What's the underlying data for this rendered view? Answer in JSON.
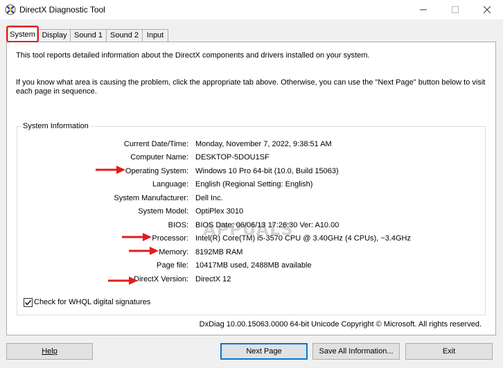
{
  "window": {
    "title": "DirectX Diagnostic Tool",
    "controls": {
      "minimize": "—",
      "maximize": "☐",
      "close": "✕"
    }
  },
  "tabs": [
    {
      "label": "System",
      "active": true
    },
    {
      "label": "Display",
      "active": false
    },
    {
      "label": "Sound 1",
      "active": false
    },
    {
      "label": "Sound 2",
      "active": false
    },
    {
      "label": "Input",
      "active": false
    }
  ],
  "intro": {
    "line1": "This tool reports detailed information about the DirectX components and drivers installed on your system.",
    "line2": "If you know what area is causing the problem, click the appropriate tab above.  Otherwise, you can use the \"Next Page\" button below to visit each page in sequence."
  },
  "system_info": {
    "title": "System Information",
    "rows": [
      {
        "label": "Current Date/Time:",
        "value": "Monday, November 7, 2022, 9:38:51 AM"
      },
      {
        "label": "Computer Name:",
        "value": "DESKTOP-5DOU1SF"
      },
      {
        "label": "Operating System:",
        "value": "Windows 10 Pro 64-bit (10.0, Build 15063)"
      },
      {
        "label": "Language:",
        "value": "English (Regional Setting: English)"
      },
      {
        "label": "System Manufacturer:",
        "value": "Dell Inc."
      },
      {
        "label": "System Model:",
        "value": "OptiPlex 3010"
      },
      {
        "label": "BIOS:",
        "value": "BIOS Date: 06/06/13 17:26:30 Ver: A10.00"
      },
      {
        "label": "Processor:",
        "value": "Intel(R) Core(TM) i5-3570 CPU @ 3.40GHz (4 CPUs), ~3.4GHz"
      },
      {
        "label": "Memory:",
        "value": "8192MB RAM"
      },
      {
        "label": "Page file:",
        "value": "10417MB used, 2488MB available"
      },
      {
        "label": "DirectX Version:",
        "value": "DirectX 12"
      }
    ]
  },
  "whql": {
    "label": "Check for WHQL digital signatures",
    "checked": true
  },
  "footer": "DxDiag 10.00.15063.0000 64-bit Unicode  Copyright © Microsoft. All rights reserved.",
  "buttons": {
    "help": "Help",
    "next_page": "Next Page",
    "save_all": "Save All Information...",
    "exit": "Exit"
  },
  "watermark": "APPUALS",
  "colors": {
    "highlight": "#e01e1e",
    "accent": "#0078d7"
  }
}
